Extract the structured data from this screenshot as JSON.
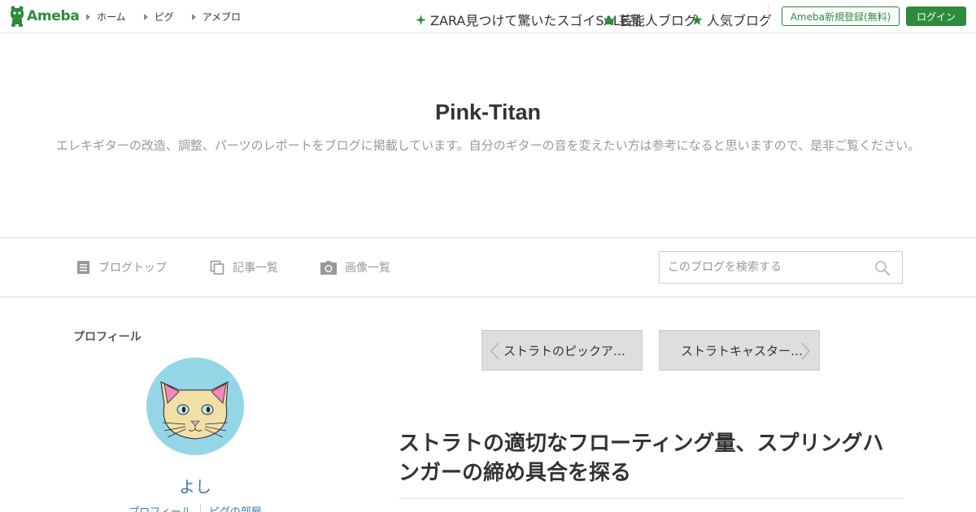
{
  "header": {
    "logo_text": "Ameba",
    "brand_color": "#2d8c3c",
    "nav": [
      {
        "label": "ホーム"
      },
      {
        "label": "ピグ"
      },
      {
        "label": "アメブロ"
      }
    ],
    "links": [
      {
        "label": "ZARA見つけて驚いたスゴイSALE品",
        "icon": "sparkle-icon"
      },
      {
        "label": "芸能人ブログ",
        "icon": "crown-icon"
      },
      {
        "label": "人気ブログ",
        "icon": "star-icon"
      }
    ],
    "register_label": "Ameba新規登録(無料)",
    "login_label": "ログイン"
  },
  "blog": {
    "title": "Pink-Titan",
    "description": "エレキギターの改造、調整、パーツのレポートをブログに掲載しています。自分のギターの音を変えたい方は参考になると思いますので、是非ご覧ください。"
  },
  "blog_nav": {
    "items": [
      {
        "label": "ブログトップ",
        "icon": "document-icon"
      },
      {
        "label": "記事一覧",
        "icon": "copy-icon"
      },
      {
        "label": "画像一覧",
        "icon": "camera-icon"
      }
    ],
    "search_placeholder": "このブログを検索する"
  },
  "sidebar": {
    "heading": "プロフィール",
    "author_name": "よし",
    "links": [
      {
        "label": "プロフィール"
      },
      {
        "label": "ピグの部屋"
      }
    ]
  },
  "main": {
    "prev_post": "ストラトのピックア…",
    "next_post": "ストラトキャスター…",
    "article_title": "ストラトの適切なフローティング量、スプリングハンガーの締め具合を探る"
  }
}
